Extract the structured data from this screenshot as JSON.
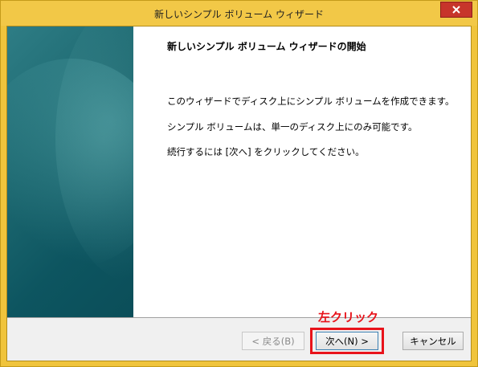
{
  "window": {
    "title": "新しいシンプル ボリューム ウィザード"
  },
  "page": {
    "heading": "新しいシンプル ボリューム ウィザードの開始",
    "paragraphs": [
      "このウィザードでディスク上にシンプル ボリュームを作成できます。",
      "シンプル ボリュームは、単一のディスク上にのみ可能です。",
      "続行するには [次へ] をクリックしてください。"
    ]
  },
  "buttons": {
    "back": "< 戻る(B)",
    "next": "次へ(N) >",
    "cancel": "キャンセル"
  },
  "annotation": {
    "label": "左クリック",
    "color": "#e8131b"
  },
  "icons": {
    "close": "close-icon"
  },
  "colors": {
    "titlebar": "#f2c847",
    "side_panel": "#1e6a72",
    "close_button": "#c7352b"
  }
}
